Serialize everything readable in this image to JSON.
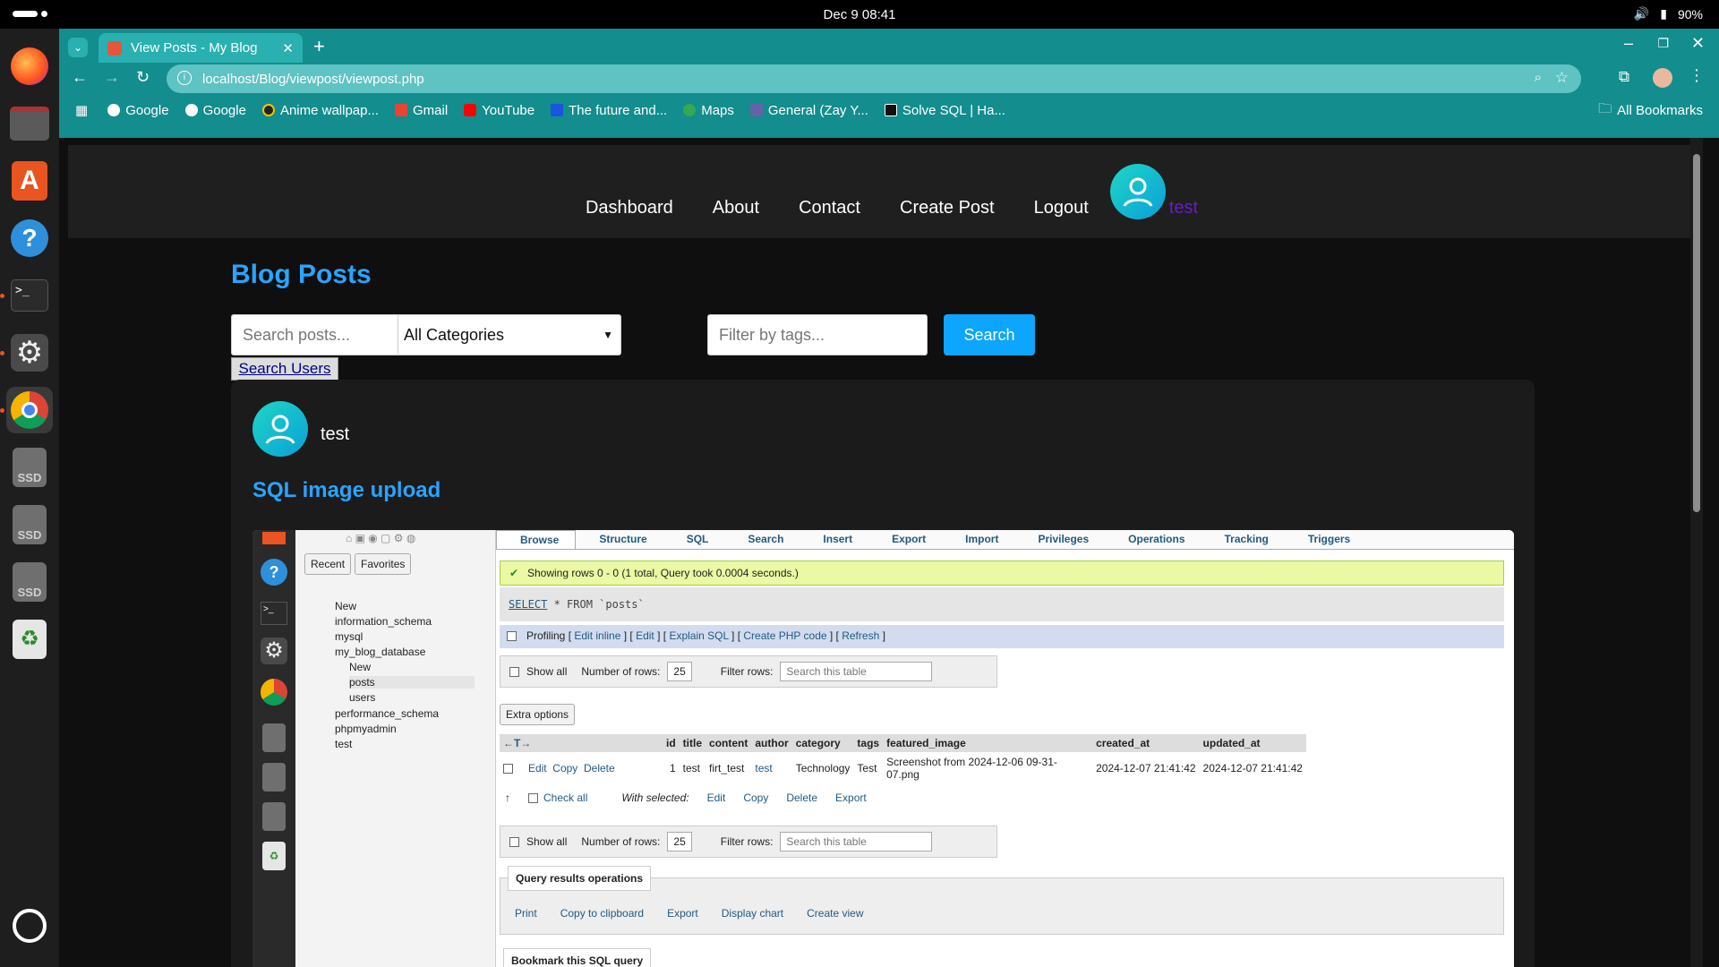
{
  "system": {
    "clock": "Dec 9  08:41",
    "battery": "90%"
  },
  "dock": {
    "ssd_label": "SSD"
  },
  "browser": {
    "tab_title": "View Posts - My Blog",
    "url": "localhost/Blog/viewpost/viewpost.php",
    "bookmarks": [
      {
        "label": "Google",
        "icon": "google-icon"
      },
      {
        "label": "Google",
        "icon": "google-icon"
      },
      {
        "label": "Anime wallpap...",
        "icon": "site-icon"
      },
      {
        "label": "Gmail",
        "icon": "gmail-icon"
      },
      {
        "label": "YouTube",
        "icon": "youtube-icon"
      },
      {
        "label": "The future and...",
        "icon": "site-icon"
      },
      {
        "label": "Maps",
        "icon": "maps-icon"
      },
      {
        "label": "General (Zay Y...",
        "icon": "site-icon"
      },
      {
        "label": "Solve SQL | Ha...",
        "icon": "hackerrank-icon"
      }
    ],
    "all_bookmarks": "All Bookmarks"
  },
  "site": {
    "nav": [
      "Dashboard",
      "About",
      "Contact",
      "Create Post",
      "Logout"
    ],
    "username": "test",
    "page_title": "Blog Posts",
    "search_placeholder": "Search posts...",
    "category_selected": "All Categories",
    "tags_placeholder": "Filter by tags...",
    "search_button": "Search",
    "search_users": "Search Users",
    "post": {
      "author": "test",
      "title": "SQL image upload"
    }
  },
  "pma": {
    "nav_tabs": [
      "Recent",
      "Favorites"
    ],
    "tree": [
      "New",
      "information_schema",
      "mysql",
      "my_blog_database",
      "New",
      "posts",
      "users",
      "performance_schema",
      "phpmyadmin",
      "test"
    ],
    "tabs": [
      "Browse",
      "Structure",
      "SQL",
      "Search",
      "Insert",
      "Export",
      "Import",
      "Privileges",
      "Operations",
      "Tracking",
      "Triggers"
    ],
    "success_msg": "Showing rows 0 - 0 (1 total, Query took 0.0004 seconds.)",
    "sql_keyword": "SELECT",
    "sql_rest": " * FROM `posts`",
    "profiling_label": "Profiling",
    "profiling_links": [
      "Edit inline",
      "Edit",
      "Explain SQL",
      "Create PHP code",
      "Refresh"
    ],
    "show_all": "Show all",
    "rows_label": "Number of rows:",
    "rows_value": "25",
    "filter_label": "Filter rows:",
    "filter_placeholder": "Search this table",
    "extra_options": "Extra options",
    "columns": [
      "id",
      "title",
      "content",
      "author",
      "category",
      "tags",
      "featured_image",
      "created_at",
      "updated_at"
    ],
    "row_actions": [
      "Edit",
      "Copy",
      "Delete"
    ],
    "row": [
      "1",
      "test",
      "firt_test",
      "test",
      "Technology",
      "Test",
      "Screenshot from 2024-12-06 09-31-07.png",
      "2024-12-07 21:41:42",
      "2024-12-07 21:41:42"
    ],
    "check_all": "Check all",
    "with_selected": "With selected:",
    "bulk_actions": [
      "Edit",
      "Copy",
      "Delete",
      "Export"
    ],
    "qro_title": "Query results operations",
    "qro_items": [
      "Print",
      "Copy to clipboard",
      "Export",
      "Display chart",
      "Create view"
    ],
    "bookmark": "Bookmark this SQL query"
  }
}
